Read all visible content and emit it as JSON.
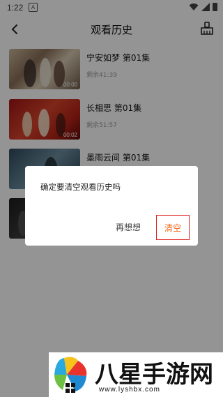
{
  "status_bar": {
    "time": "1:22",
    "a_badge": "A"
  },
  "header": {
    "title": "观看历史"
  },
  "history": [
    {
      "title": "宁安如梦 第01集",
      "remaining": "剩余41:39",
      "duration": "00:00"
    },
    {
      "title": "长相思 第01集",
      "remaining": "剩余51:57",
      "duration": "00:02"
    },
    {
      "title": "墨雨云间 第01集",
      "remaining": "",
      "duration": ""
    },
    {
      "title": "",
      "remaining": "",
      "duration": ""
    }
  ],
  "dialog": {
    "message": "确定要清空观看历史吗",
    "cancel_label": "再想想",
    "confirm_label": "清空"
  },
  "watermark": {
    "title": "八星手游网",
    "url": "www.lyshbx.com"
  },
  "colors": {
    "accent": "#f06a1a",
    "highlight_border": "#e02020",
    "overlay": "rgba(0,0,0,0.42)"
  }
}
